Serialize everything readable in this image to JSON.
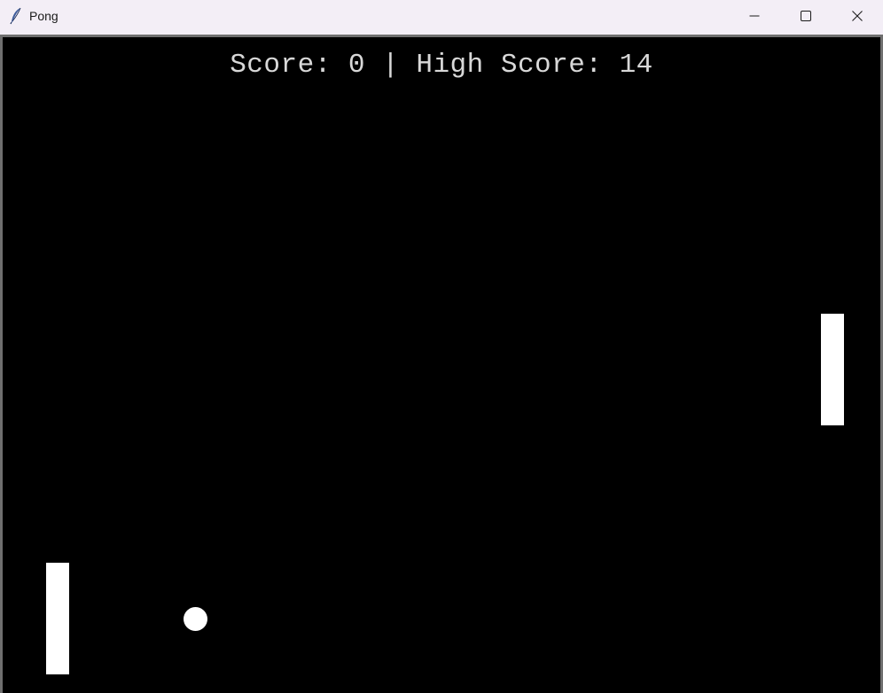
{
  "window": {
    "title": "Pong",
    "app_icon": "feather-icon",
    "controls": {
      "minimize_icon": "minimize-icon",
      "maximize_icon": "maximize-icon",
      "close_icon": "close-icon"
    }
  },
  "game": {
    "score_text": "Score: 0 | High Score: 14",
    "score": 0,
    "high_score": 14,
    "background_color": "#000000",
    "foreground_color": "#ffffff"
  }
}
